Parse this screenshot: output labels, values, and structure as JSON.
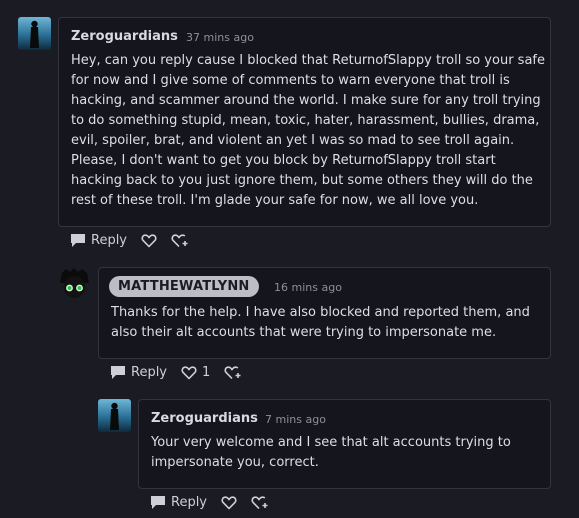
{
  "comments": [
    {
      "author": "Zeroguardians",
      "time": "37 mins ago",
      "text": "Hey, can you reply cause I blocked that ReturnofSlappy troll so your safe for now and I give some of comments to warn everyone that troll is hacking, and scammer around the world. I make sure for any troll trying to do something stupid, mean, toxic, hater, harassment, bullies, drama, evil, spoiler, brat, and violent an yet I was so mad to see troll again. Please, I don't want to get you block by ReturnofSlappy troll start hacking back to you just ignore them, but some others they will do the rest of these troll. I'm glade your safe for now, we all love you.",
      "reply_label": "Reply",
      "like_count": ""
    },
    {
      "author": "MATTHEWATLYNN",
      "time": "16 mins ago",
      "text": "Thanks for the help. I have also blocked and reported them, and also their alt accounts that were trying to impersonate me.",
      "reply_label": "Reply",
      "like_count": "1"
    },
    {
      "author": "Zeroguardians",
      "time": "7 mins ago",
      "text": "Your very welcome and I see that alt accounts trying to impersonate you, correct.",
      "reply_label": "Reply",
      "like_count": ""
    }
  ],
  "icons": {
    "reply": "speech-bubble-icon",
    "like": "heart-icon",
    "react": "heart-plus-icon"
  },
  "colors": {
    "background": "#1b1b24",
    "card": "#15151d",
    "badge": "#bdbdc6"
  }
}
